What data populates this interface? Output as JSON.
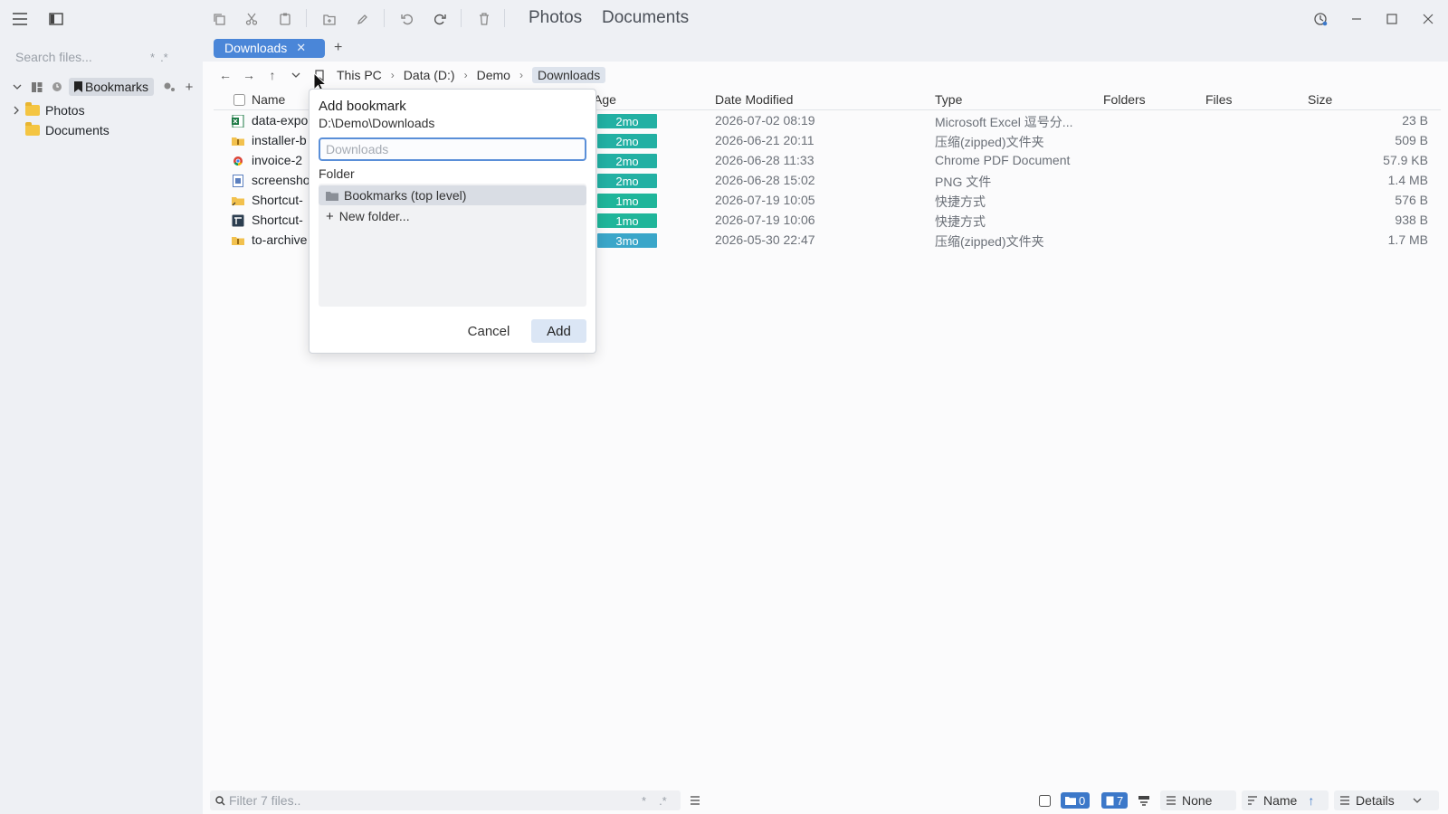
{
  "titlebar": {
    "crumbs": [
      "Photos",
      "Documents"
    ]
  },
  "sidebar": {
    "search_placeholder": "Search files...",
    "search_tokens": [
      "*",
      ".*"
    ],
    "bookmarks_tab": "Bookmarks",
    "items": [
      {
        "label": "Photos"
      },
      {
        "label": "Documents"
      }
    ]
  },
  "tabs": {
    "active": "Downloads"
  },
  "breadcrumb": [
    "This PC",
    "Data (D:)",
    "Demo",
    "Downloads"
  ],
  "columns": {
    "name": "Name",
    "age": "Age",
    "date": "Date Modified",
    "type": "Type",
    "folders": "Folders",
    "files": "Files",
    "size": "Size"
  },
  "files": [
    {
      "name": "data-expo",
      "age": "2mo",
      "date": "2026-07-02 08:19",
      "type": "Microsoft Excel 逗号分...",
      "size": "23 B",
      "icon": "excel-icon",
      "age_color": "#22b0a3"
    },
    {
      "name": "installer-b",
      "age": "2mo",
      "date": "2026-06-21 20:11",
      "type": "压缩(zipped)文件夹",
      "size": "509 B",
      "icon": "zip-folder-icon",
      "age_color": "#22b0a3"
    },
    {
      "name": "invoice-2",
      "age": "2mo",
      "date": "2026-06-28 11:33",
      "type": "Chrome PDF Document",
      "size": "57.9 KB",
      "icon": "chrome-icon",
      "age_color": "#22b0a3"
    },
    {
      "name": "screensho",
      "age": "2mo",
      "date": "2026-06-28 15:02",
      "type": "PNG 文件",
      "size": "1.4 MB",
      "icon": "image-file-icon",
      "age_color": "#22b0a3"
    },
    {
      "name": "Shortcut-",
      "age": "1mo",
      "date": "2026-07-19 10:05",
      "type": "快捷方式",
      "size": "576 B",
      "icon": "shortcut-folder-icon",
      "age_color": "#1fb59a"
    },
    {
      "name": "Shortcut-",
      "age": "1mo",
      "date": "2026-07-19 10:06",
      "type": "快捷方式",
      "size": "938 B",
      "icon": "shortcut-app-icon",
      "age_color": "#1fb59a"
    },
    {
      "name": "to-archive",
      "age": "3mo",
      "date": "2026-05-30 22:47",
      "type": "压缩(zipped)文件夹",
      "size": "1.7 MB",
      "icon": "zip-folder-icon",
      "age_color": "#3aa6c9"
    }
  ],
  "bookmark_dialog": {
    "title": "Add bookmark",
    "path": "D:\\Demo\\Downloads",
    "name_placeholder": "Downloads",
    "folder_label": "Folder",
    "selected_folder": "Bookmarks (top level)",
    "new_folder": "New folder...",
    "cancel": "Cancel",
    "add": "Add"
  },
  "statusbar": {
    "filter_placeholder": "Filter 7 files..",
    "filter_tokens": [
      "*",
      ".*"
    ],
    "folders_count": "0",
    "files_count": "7",
    "group": "None",
    "sort": "Name",
    "view": "Details"
  }
}
